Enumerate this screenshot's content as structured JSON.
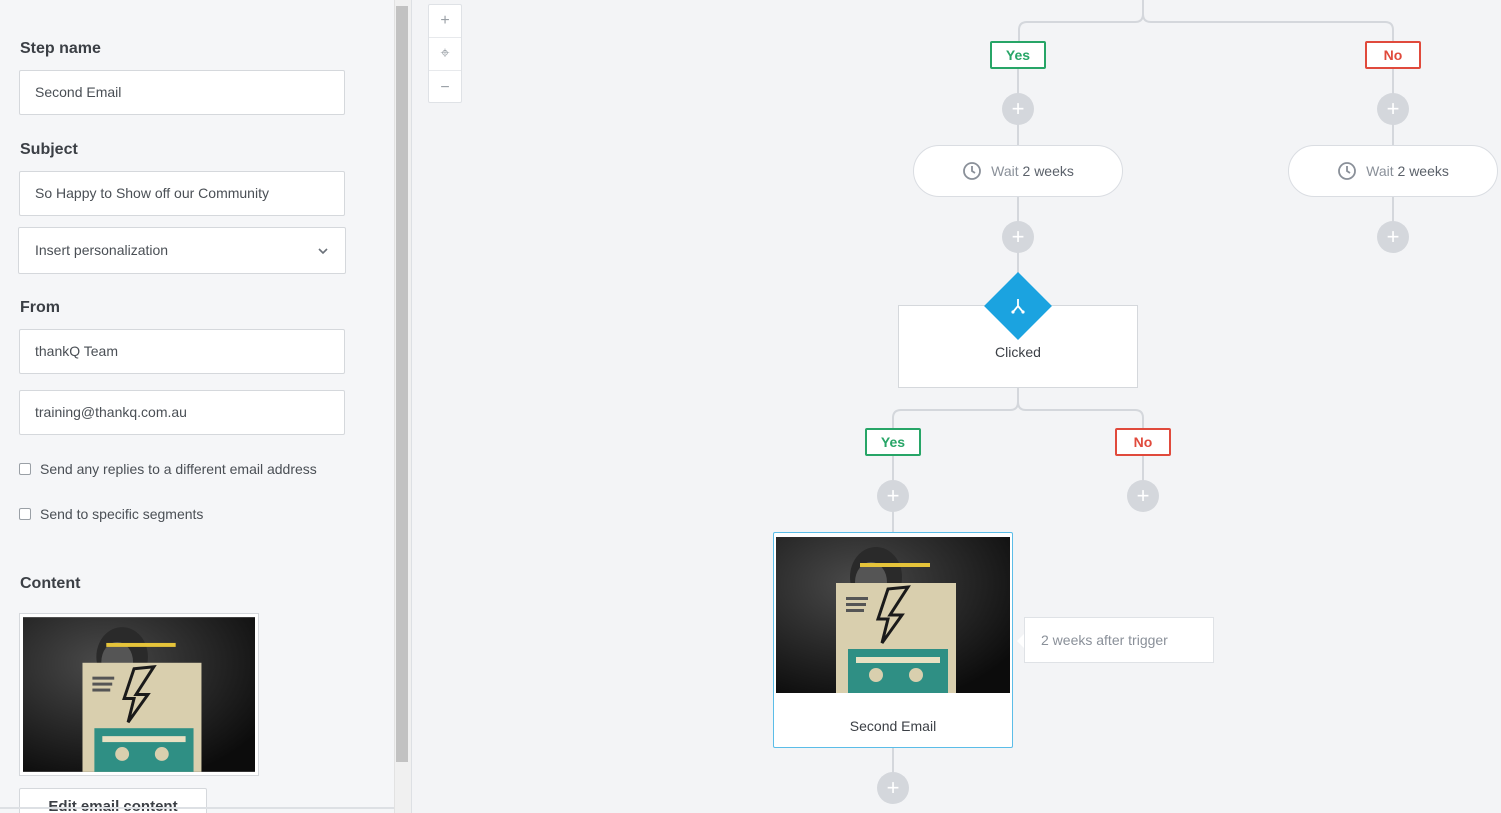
{
  "panel": {
    "step_name_label": "Step name",
    "step_name_value": "Second Email",
    "subject_label": "Subject",
    "subject_value": "So Happy to Show off our Community",
    "personalization_select": "Insert personalization",
    "from_label": "From",
    "from_name_value": "thankQ Team",
    "from_email_value": "training@thankq.com.au",
    "checkbox_replies": "Send any replies to a different email address",
    "checkbox_segments": "Send to specific segments",
    "content_label": "Content",
    "edit_email_button": "Edit email content"
  },
  "canvas": {
    "zoom": {
      "in": "+",
      "fit": "⌖",
      "out": "−"
    },
    "branch_yes": "Yes",
    "branch_no": "No",
    "add_symbol": "+",
    "wait": {
      "prefix": "Wait",
      "amount": "2",
      "unit": "weeks"
    },
    "condition_label": "Clicked",
    "email_step_label": "Second Email",
    "tooltip": "2 weeks after trigger"
  },
  "colors": {
    "yes": "#27a567",
    "no": "#e04a3c",
    "condition": "#1ba3e0",
    "selected_border": "#5bbde8",
    "connector": "#d4d7dc"
  },
  "icons": [
    "chevron-down-icon",
    "clock-icon",
    "split-icon",
    "plus-icon",
    "fit-icon",
    "minus-icon"
  ]
}
